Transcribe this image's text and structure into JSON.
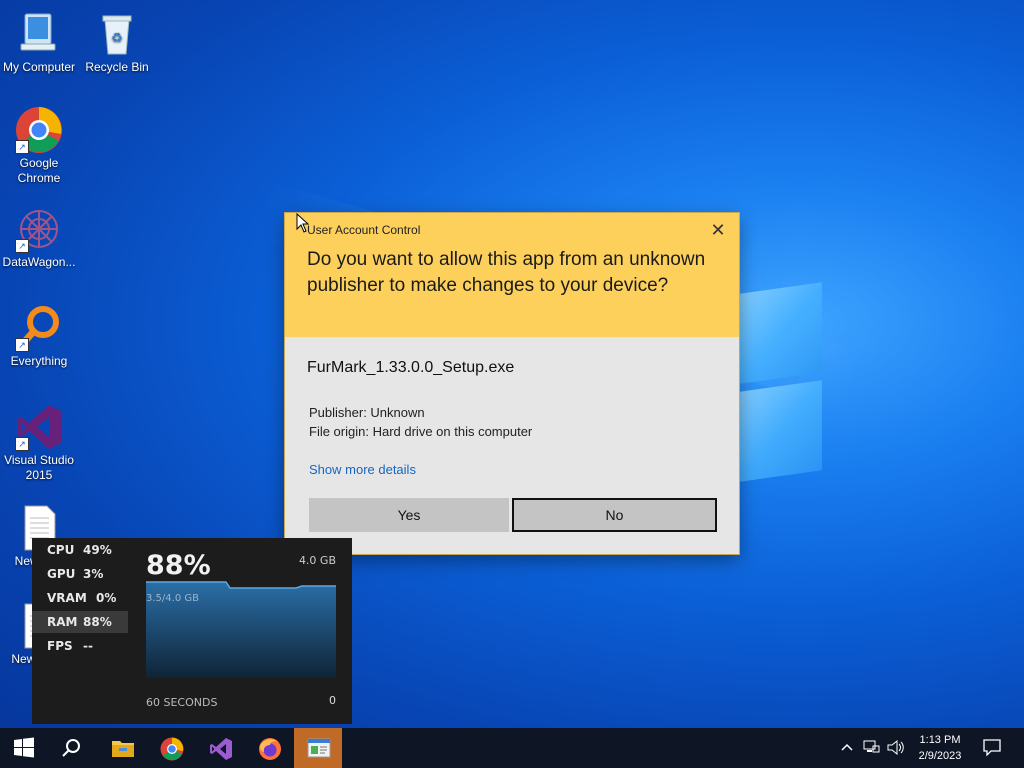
{
  "desktop": {
    "icons": [
      {
        "label": "My Computer"
      },
      {
        "label": "Recycle Bin"
      },
      {
        "label": "Google Chrome"
      },
      {
        "label": "DataWagon..."
      },
      {
        "label": "Everything"
      },
      {
        "label": "Visual Studio 2015"
      },
      {
        "label": "New Doc"
      },
      {
        "label": "New Docu"
      }
    ]
  },
  "uac": {
    "title": "User Account Control",
    "close": "✕",
    "question": "Do you want to allow this app from an unknown publisher to make changes to your device?",
    "app_name": "FurMark_1.33.0.0_Setup.exe",
    "publisher": "Publisher: Unknown",
    "origin": "File origin: Hard drive on this computer",
    "more_details": "Show more details",
    "yes_label": "Yes",
    "no_label": "No",
    "accent_color": "#fdd05b"
  },
  "perf_overlay": {
    "rows": [
      {
        "key": "CPU",
        "value": "49%"
      },
      {
        "key": "GPU",
        "value": "3%"
      },
      {
        "key": "VRAM",
        "value": "0%"
      },
      {
        "key": "RAM",
        "value": "88%"
      },
      {
        "key": "FPS",
        "value": "--"
      }
    ],
    "selected": "RAM",
    "big_value": "88%",
    "max_label": "4.0 GB",
    "used_label": "3.5/4.0 GB",
    "time_label": "60 SECONDS",
    "min_label": "0"
  },
  "taskbar": {
    "apps": [
      "start-icon",
      "search-icon",
      "file-explorer-icon",
      "chrome-icon",
      "visual-studio-icon",
      "firefox-icon",
      "installer-icon"
    ],
    "active_app": "installer-icon",
    "time": "1:13 PM",
    "date": "2/9/2023"
  }
}
